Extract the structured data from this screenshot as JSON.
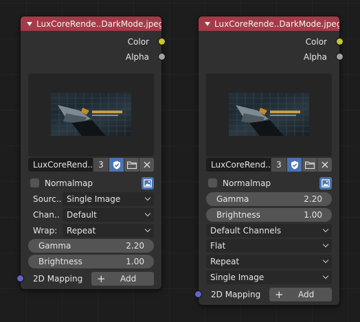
{
  "colors": {
    "header": "#a53a48",
    "node_body": "#303030",
    "socket_color": "#c7c729",
    "socket_alpha": "#a1a1a1",
    "socket_vector": "#6363c7",
    "accent_blue": "#4a73b3"
  },
  "nodes": [
    {
      "title": "LuxCoreRende..DarkMode.jpeg",
      "outputs": {
        "color": "Color",
        "alpha": "Alpha"
      },
      "image": {
        "name": "LuxCoreRend..",
        "users": "3",
        "fake_user_icon": "shield-check-icon",
        "browse_icon": "folder-icon",
        "unlink_icon": "close-icon"
      },
      "normalmap": {
        "label": "Normalmap",
        "checked": false
      },
      "source": {
        "label": "Sourc..",
        "value": "Single Image"
      },
      "channels": {
        "label": "Chan..",
        "value": "Default"
      },
      "wrap": {
        "label": "Wrap:",
        "value": "Repeat"
      },
      "gamma": {
        "label": "Gamma",
        "value": "2.20"
      },
      "brightness": {
        "label": "Brightness",
        "value": "1.00"
      },
      "mapping": {
        "label": "2D Mapping",
        "add_plus": "+",
        "add_label": "Add"
      }
    },
    {
      "title": "LuxCoreRende..DarkMode.jpeg",
      "outputs": {
        "color": "Color",
        "alpha": "Alpha"
      },
      "image": {
        "name": "LuxCoreRend..",
        "users": "3",
        "fake_user_icon": "shield-check-icon",
        "browse_icon": "folder-icon",
        "unlink_icon": "close-icon"
      },
      "normalmap": {
        "label": "Normalmap",
        "checked": false
      },
      "gamma": {
        "label": "Gamma",
        "value": "2.20"
      },
      "brightness": {
        "label": "Brightness",
        "value": "1.00"
      },
      "channels": {
        "value": "Default Channels"
      },
      "projection": {
        "value": "Flat"
      },
      "wrap": {
        "value": "Repeat"
      },
      "source": {
        "value": "Single Image"
      },
      "mapping": {
        "label": "2D Mapping",
        "add_plus": "+",
        "add_label": "Add"
      }
    }
  ]
}
